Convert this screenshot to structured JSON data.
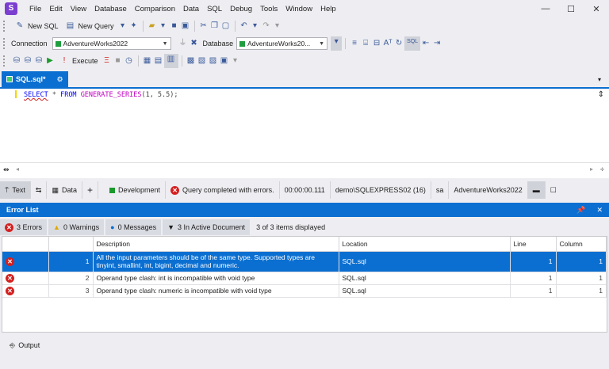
{
  "menu": [
    "File",
    "Edit",
    "View",
    "Database",
    "Comparison",
    "Data",
    "SQL",
    "Debug",
    "Tools",
    "Window",
    "Help"
  ],
  "window_controls": [
    "—",
    "☐",
    "✕"
  ],
  "toolbar1": {
    "new_sql": "New SQL",
    "new_query": "New Query"
  },
  "toolbar2": {
    "connection_label": "Connection",
    "connection_value": "AdventureWorks2022",
    "database_label": "Database",
    "database_value": "AdventureWorks20..."
  },
  "toolbar3": {
    "execute": "Execute"
  },
  "doc_tab": {
    "title": "SQL.sql*"
  },
  "editor": {
    "kw1": "SELECT",
    "star": " * ",
    "kw2": "FROM",
    "fn": "GENERATE_SERIES",
    "args": "(1, 5.5);"
  },
  "statusbar": {
    "text_tab": "Text",
    "data_tab": "Data",
    "add": "+",
    "environment": "Development",
    "query_status": "Query completed with errors.",
    "duration": "00:00:00.111",
    "server": "demo\\SQLEXPRESS02 (16)",
    "user": "sa",
    "database": "AdventureWorks2022"
  },
  "error_list": {
    "title": "Error List",
    "pin": "📌",
    "close": "✕",
    "errors_btn": "3 Errors",
    "warnings_btn": "0 Warnings",
    "messages_btn": "0 Messages",
    "active_doc_btn": "3 In Active Document",
    "displayed": "3 of 3 items displayed",
    "columns": [
      "",
      "",
      "Description",
      "Location",
      "Line",
      "Column"
    ],
    "rows": [
      {
        "num": "1",
        "desc": "All the input parameters should be of the same type. Supported types are tinyint, smallint, int, bigint, decimal and numeric.",
        "loc": "SQL.sql",
        "line": "1",
        "col": "1"
      },
      {
        "num": "2",
        "desc": "Operand type clash: int is incompatible with void type",
        "loc": "SQL.sql",
        "line": "1",
        "col": "1"
      },
      {
        "num": "3",
        "desc": "Operand type clash: numeric is incompatible with void type",
        "loc": "SQL.sql",
        "line": "1",
        "col": "1"
      }
    ]
  },
  "output": {
    "label": "Output"
  }
}
